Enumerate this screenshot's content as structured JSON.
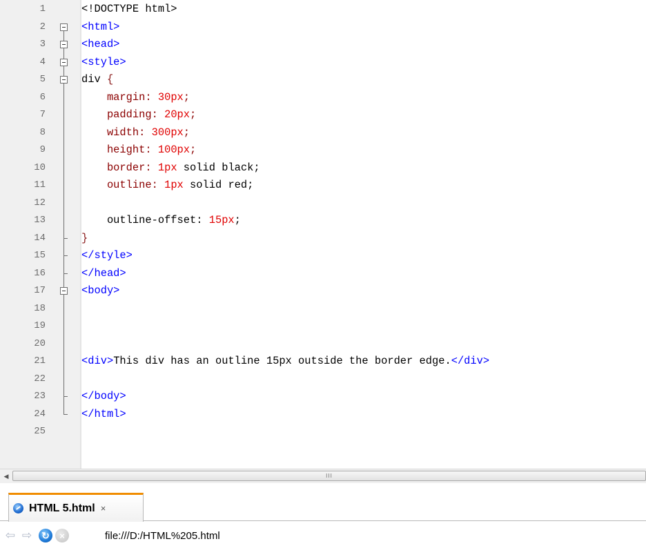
{
  "editor": {
    "line_numbers": [
      "1",
      "2",
      "3",
      "4",
      "5",
      "6",
      "7",
      "8",
      "9",
      "10",
      "11",
      "12",
      "13",
      "14",
      "15",
      "16",
      "17",
      "18",
      "19",
      "20",
      "21",
      "22",
      "23",
      "24",
      "25"
    ],
    "lines": [
      [
        {
          "t": "<!DOCTYPE html>",
          "c": "dt"
        }
      ],
      [
        {
          "t": "<html>",
          "c": "tag"
        }
      ],
      [
        {
          "t": "<head>",
          "c": "tag"
        }
      ],
      [
        {
          "t": "<style>",
          "c": "tag"
        }
      ],
      [
        {
          "t": "div ",
          "c": "sel"
        },
        {
          "t": "{",
          "c": "brace"
        }
      ],
      [
        {
          "t": "    margin: ",
          "c": "prop"
        },
        {
          "t": "30px",
          "c": "num"
        },
        {
          "t": ";",
          "c": "prop"
        }
      ],
      [
        {
          "t": "    padding: ",
          "c": "prop"
        },
        {
          "t": "20px",
          "c": "num"
        },
        {
          "t": ";",
          "c": "prop"
        }
      ],
      [
        {
          "t": "    width: ",
          "c": "prop"
        },
        {
          "t": "300px",
          "c": "num"
        },
        {
          "t": ";",
          "c": "prop"
        }
      ],
      [
        {
          "t": "    height: ",
          "c": "prop"
        },
        {
          "t": "100px",
          "c": "num"
        },
        {
          "t": ";",
          "c": "prop"
        }
      ],
      [
        {
          "t": "    border: ",
          "c": "prop"
        },
        {
          "t": "1px",
          "c": "num"
        },
        {
          "t": " solid black;",
          "c": "kw"
        }
      ],
      [
        {
          "t": "    outline: ",
          "c": "prop"
        },
        {
          "t": "1px",
          "c": "num"
        },
        {
          "t": " solid red;",
          "c": "kw"
        }
      ],
      [],
      [
        {
          "t": "    outline-offset: ",
          "c": "kw"
        },
        {
          "t": "15px",
          "c": "num"
        },
        {
          "t": ";",
          "c": "kw"
        }
      ],
      [
        {
          "t": "}",
          "c": "brace"
        }
      ],
      [
        {
          "t": "</style>",
          "c": "tag"
        }
      ],
      [
        {
          "t": "</head>",
          "c": "tag"
        }
      ],
      [
        {
          "t": "<body>",
          "c": "tag"
        }
      ],
      [],
      [],
      [],
      [
        {
          "t": "<div>",
          "c": "tag"
        },
        {
          "t": "This div has an outline 15px outside the border edge.",
          "c": "txt"
        },
        {
          "t": "</div>",
          "c": "tag"
        }
      ],
      [],
      [
        {
          "t": "</body>",
          "c": "tag"
        }
      ],
      [
        {
          "t": "</html>",
          "c": "tag"
        }
      ],
      []
    ]
  },
  "scrollbar": {
    "grip": "III",
    "left_arrow": "◀"
  },
  "tab": {
    "label": "HTML 5.html",
    "close": "×"
  },
  "nav": {
    "back_icon": "⇦",
    "forward_icon": "⇨",
    "reload_icon": "↻",
    "stop_icon": "×",
    "address": "file:///D:/HTML%205.html"
  },
  "colors": {
    "tag": "#0000ff",
    "property": "#8b0000",
    "number": "#e00000",
    "tab_accent": "#f08c00"
  }
}
